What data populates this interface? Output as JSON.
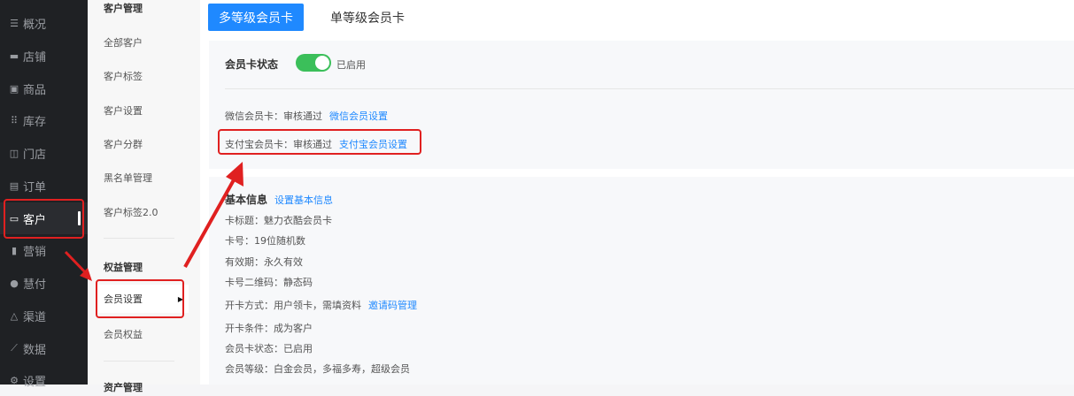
{
  "sidebar": {
    "items": [
      {
        "icon": "menu-icon",
        "glyph": "☰",
        "label": "概况"
      },
      {
        "icon": "store-icon",
        "glyph": "▬",
        "label": "店铺"
      },
      {
        "icon": "goods-icon",
        "glyph": "▣",
        "label": "商品"
      },
      {
        "icon": "inventory-icon",
        "glyph": "⠿",
        "label": "库存"
      },
      {
        "icon": "shop-icon",
        "glyph": "◫",
        "label": "门店"
      },
      {
        "icon": "order-icon",
        "glyph": "▤",
        "label": "订单"
      },
      {
        "icon": "customer-icon",
        "glyph": "▭",
        "label": "客户"
      },
      {
        "icon": "marketing-icon",
        "glyph": "▮",
        "label": "营销"
      },
      {
        "icon": "pay-icon",
        "glyph": "●",
        "label": "慧付"
      },
      {
        "icon": "channel-icon",
        "glyph": "△",
        "label": "渠道"
      },
      {
        "icon": "data-icon",
        "glyph": "⟋",
        "label": "数据"
      },
      {
        "icon": "settings-icon",
        "glyph": "⚙",
        "label": "设置"
      }
    ]
  },
  "submenu": {
    "customer_title": "客户管理",
    "customer_items": [
      "全部客户",
      "客户标签",
      "客户设置",
      "客户分群",
      "黑名单管理",
      "客户标签2.0"
    ],
    "rights_title": "权益管理",
    "rights_items": [
      "会员设置",
      "会员权益"
    ],
    "bottom_title": "资产管理"
  },
  "tabs": [
    "多等级会员卡",
    "单等级会员卡"
  ],
  "status_panel": {
    "label": "会员卡状态",
    "toggle_text": "已启用",
    "wechat": {
      "text": "微信会员卡：审核通过",
      "link": "微信会员设置"
    },
    "alipay": {
      "text": "支付宝会员卡：审核通过",
      "link": "支付宝会员设置"
    }
  },
  "basic_panel": {
    "title": "基本信息",
    "title_link": "设置基本信息",
    "rows": [
      "卡标题：魅力衣酷会员卡",
      "卡号：19位随机数",
      "有效期：永久有效",
      "卡号二维码：静态码",
      "开卡方式：用户领卡，需填资料",
      "开卡条件：成为客户",
      "会员卡状态：已启用",
      "会员等级：白金会员，多福多寿，超级会员"
    ],
    "invite_link": "邀请码管理"
  },
  "colors": {
    "accent": "#1f89ff",
    "highlight": "#e02020",
    "toggle_on": "#3bbf5a"
  }
}
